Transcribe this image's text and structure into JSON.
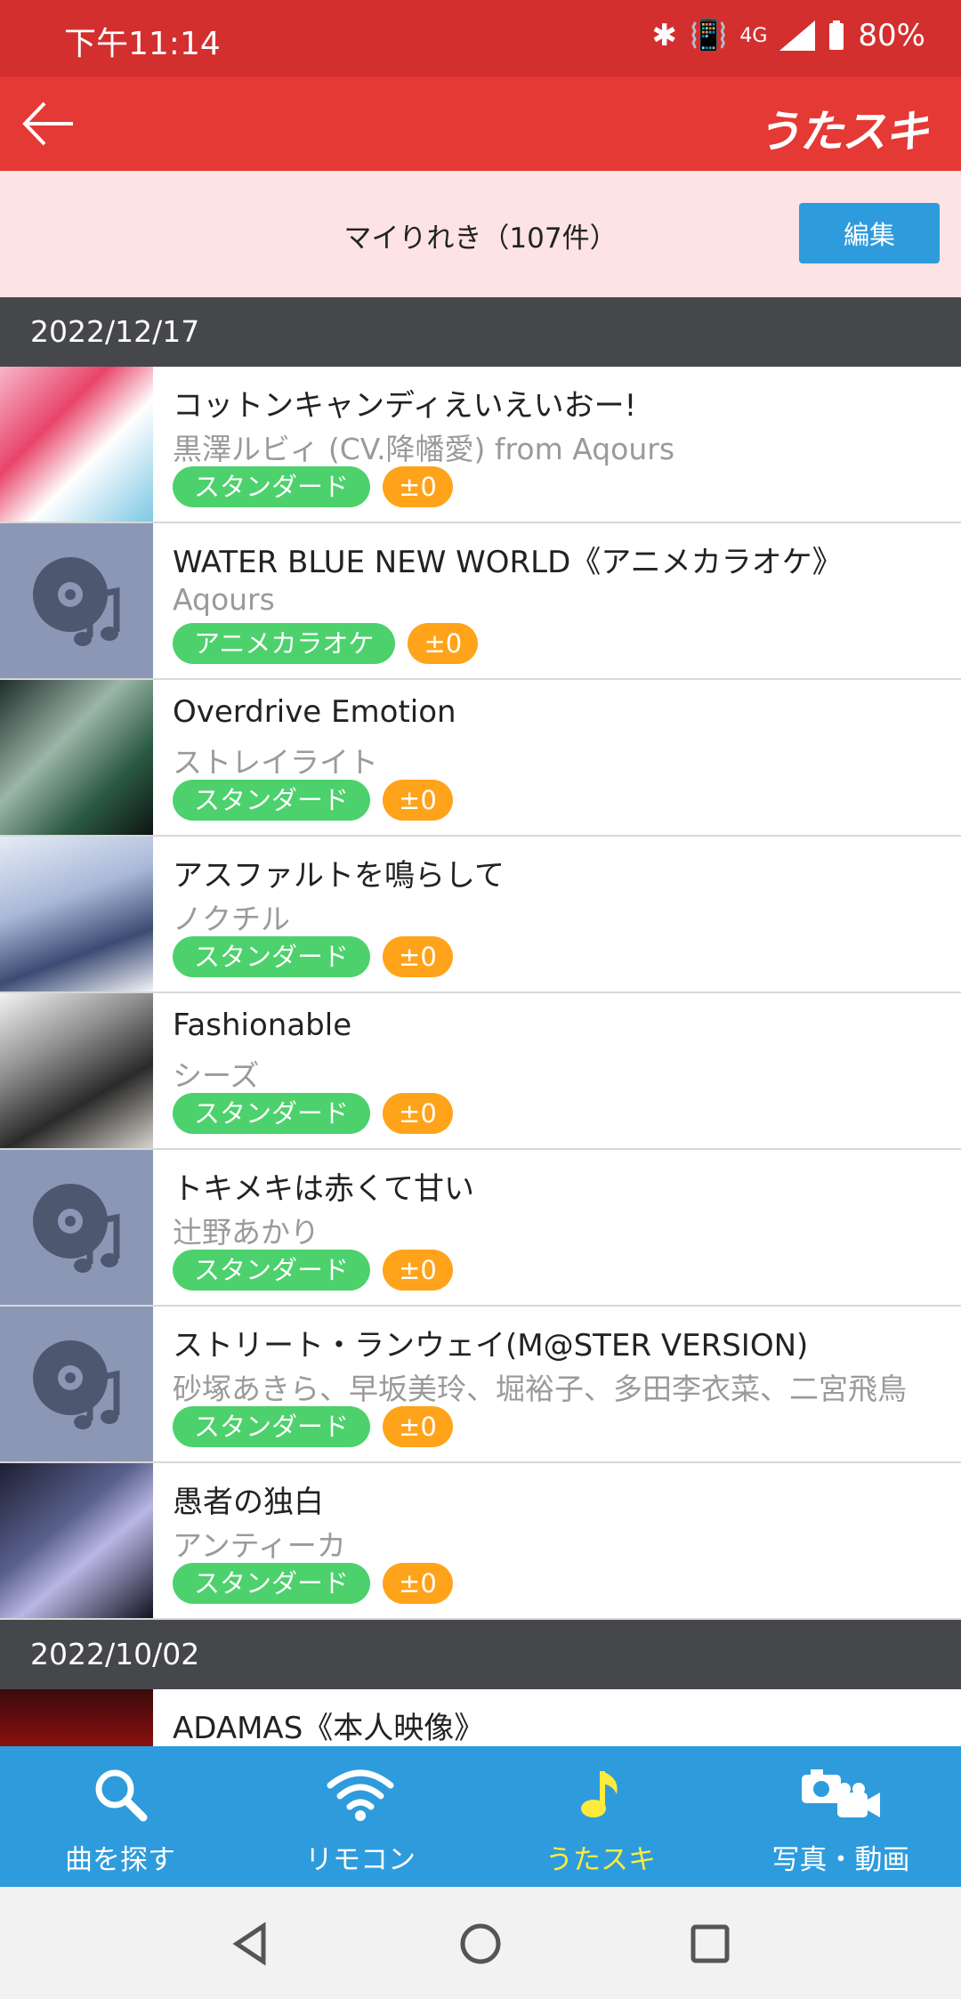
{
  "status_bar": {
    "time": "下午11:14",
    "network": "4G",
    "battery": "80%"
  },
  "app": {
    "logo": "うたスキ"
  },
  "history": {
    "title": "マイりれき（107件）",
    "edit_label": "編集"
  },
  "groups": [
    {
      "date": "2022/12/17",
      "items": [
        {
          "song": "コットンキャンディえいえいおー!",
          "artist": "黒澤ルビィ (CV.降幡愛) from Aqours",
          "mode": "スタンダード",
          "score": "±0"
        },
        {
          "song": "WATER BLUE NEW WORLD《アニメカラオケ》",
          "artist": "Aqours",
          "mode": "アニメカラオケ",
          "score": "±0"
        },
        {
          "song": "Overdrive Emotion",
          "artist": "ストレイライト",
          "mode": "スタンダード",
          "score": "±0"
        },
        {
          "song": "アスファルトを鳴らして",
          "artist": "ノクチル",
          "mode": "スタンダード",
          "score": "±0"
        },
        {
          "song": "Fashionable",
          "artist": "シーズ",
          "mode": "スタンダード",
          "score": "±0"
        },
        {
          "song": "トキメキは赤くて甘い",
          "artist": "辻野あかり",
          "mode": "スタンダード",
          "score": "±0"
        },
        {
          "song": "ストリート・ランウェイ(M@STER VERSION)",
          "artist": "砂塚あきら、早坂美玲、堀裕子、多田李衣菜、二宮飛鳥",
          "mode": "スタンダード",
          "score": "±0"
        },
        {
          "song": "愚者の独白",
          "artist": "アンティーカ",
          "mode": "スタンダード",
          "score": "±0"
        }
      ]
    },
    {
      "date": "2022/10/02",
      "items": [
        {
          "song": "ADAMAS《本人映像》",
          "artist": "",
          "mode": "",
          "score": ""
        }
      ]
    }
  ],
  "bottom_nav": [
    {
      "label": "曲を探す",
      "icon": "search-icon"
    },
    {
      "label": "リモコン",
      "icon": "wifi-remote-icon"
    },
    {
      "label": "うたスキ",
      "icon": "music-note-icon",
      "active": true
    },
    {
      "label": "写真・動画",
      "icon": "camera-video-icon"
    }
  ],
  "colors": {
    "status_bar": "#d32f2f",
    "app_bar": "#e53935",
    "header_bg": "#fde3e3",
    "edit_button": "#2e9bdc",
    "date_header": "#45474b",
    "mode_tag": "#4cd16c",
    "score_tag": "#ffa31a",
    "bottom_nav": "#2e9bdc",
    "active_nav": "#ffeb3b"
  }
}
